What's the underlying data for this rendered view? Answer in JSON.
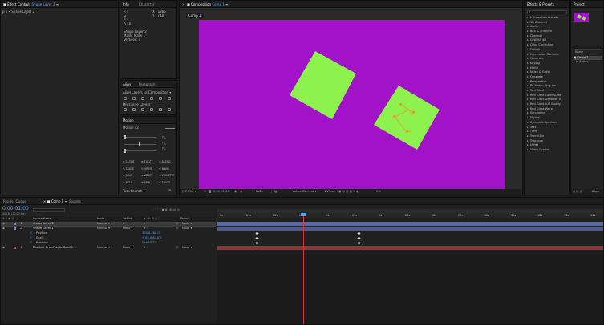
{
  "effect_controls": {
    "tab": "Effect Controls",
    "layer_link": "Shape Layer 2",
    "breadcrumb": "p 1 • Shape Layer 2"
  },
  "info": {
    "tabs": [
      "Info",
      "Character"
    ],
    "x_label": "X : 1385",
    "y_label": "Y : 748",
    "a_label": "A : 0",
    "shape_line1": "Shape Layer 2",
    "shape_line2": "Mask: Mask 1",
    "shape_line3": "Vertices: 4"
  },
  "align": {
    "tabs": [
      "Align",
      "Paragraph"
    ],
    "align_to_label": "Align Layers to:",
    "align_to_value": "Composition",
    "distribute_label": "Distribute Layers:"
  },
  "motion": {
    "tab": "Motion",
    "version": "Motion v2",
    "btns_col1": [
      "⊕ CLONE",
      "⤡ STAGE",
      "⊕ JUMP",
      "⊕ ROLL"
    ],
    "btns_col2": [
      "⊕ EXCITE",
      "↻ ORBIT",
      "⊕ WARP",
      "⊕ SPIN"
    ],
    "btns_col3": [
      "⊕ BLEND",
      "⊕ NAME",
      "⊕ VIGNETTE",
      "⊕ TRACK"
    ],
    "task_launch": "Task Launch"
  },
  "composition": {
    "tab": "Composition",
    "tab_link": "Comp 1",
    "subtab": "Comp 1",
    "bg_color": "#a212c8",
    "shape_color": "#8ef24e",
    "footer": {
      "zoom": "(17.8%)",
      "timecode": "0;00;01;00",
      "quality": "Full",
      "camera": "Active Camera",
      "view": "1 View",
      "exposure": "+0.0"
    }
  },
  "effects_presets": {
    "tab": "Effects & Presets",
    "items": [
      "* Animation Presets",
      "3D Channel",
      "Audio",
      "Blur & Sharpen",
      "Channel",
      "CINEMA 4D",
      "Color Correction",
      "Distort",
      "Expression Controls",
      "Generate",
      "Keying",
      "Matte",
      "Noise & Grain",
      "Obsolete",
      "Perspective",
      "RE:Vision Plug-ins",
      "Red Giant",
      "Red Giant Color Suite",
      "Red Giant Denoiser II",
      "Red Giant LUT Buddy",
      "Red Giant Warp",
      "Simulation",
      "Stylize",
      "Synthetic Aperture",
      "Text",
      "Time",
      "Transition",
      "Trapcode",
      "Utility",
      "Video Copilot"
    ]
  },
  "project": {
    "tab": "Project",
    "name_header": "Name",
    "items": [
      "Comp 1",
      "Solids"
    ],
    "footer": "8 bpc"
  },
  "timeline": {
    "tabs": [
      "Render Queue",
      "Comp 1",
      "Sounds"
    ],
    "timecode": "0;00;01;00",
    "fps": "00030 (30.00 fps)",
    "col_source": "Source Name",
    "col_mode": "Mode",
    "col_trkmat": "TrkMat",
    "col_parent": "Parent",
    "layers": [
      {
        "num": "1",
        "name": "Shape Layer 2",
        "mode": "Normal",
        "trkmat": "",
        "parent": "None",
        "color": "#7d8fd8"
      },
      {
        "num": "2",
        "name": "Shape Layer 1",
        "mode": "Normal",
        "trkmat": "None",
        "parent": "None",
        "color": "#7d8fd8"
      },
      {
        "num": "",
        "name": "Position",
        "value": "700.0,368.0"
      },
      {
        "num": "",
        "name": "Scale",
        "value": "∞ 67.0,67.0%"
      },
      {
        "num": "",
        "name": "Rotation",
        "value": "0x+34.7°"
      },
      {
        "num": "3",
        "name": "Medium Gray-Purple Solid 1",
        "mode": "Normal",
        "trkmat": "None",
        "parent": "None",
        "color": "#d04848"
      }
    ],
    "ruler": [
      "0s",
      "01s",
      "02s",
      "03s",
      "04s",
      "05s",
      "06s",
      "07s",
      "08s",
      "09s",
      "10s",
      "11s",
      "12s",
      "13s",
      "14s"
    ]
  }
}
